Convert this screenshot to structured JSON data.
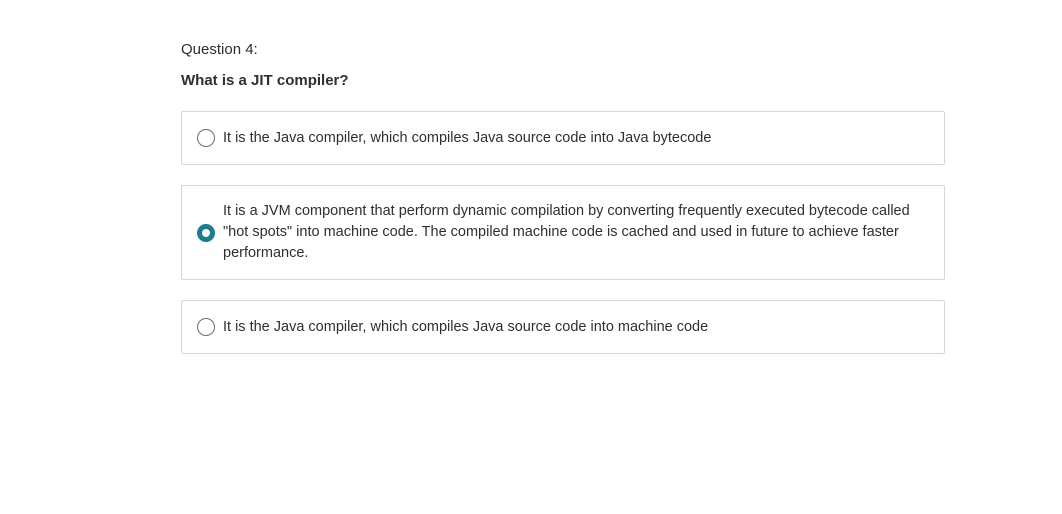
{
  "question": {
    "number_label": "Question 4:",
    "prompt": "What is a JIT compiler?"
  },
  "options": [
    {
      "text": "It is the Java compiler, which compiles Java source code into Java bytecode",
      "selected": false
    },
    {
      "text": "It is a JVM component that perform dynamic compilation by converting frequently executed bytecode called \"hot spots\" into machine code. The compiled machine code is cached and used in future to achieve faster performance.",
      "selected": true
    },
    {
      "text": "It is the Java compiler, which compiles Java source code into machine code",
      "selected": false
    }
  ],
  "colors": {
    "accent": "#1c7e8d",
    "border": "#d1d7dc",
    "text": "#2d2f31"
  }
}
